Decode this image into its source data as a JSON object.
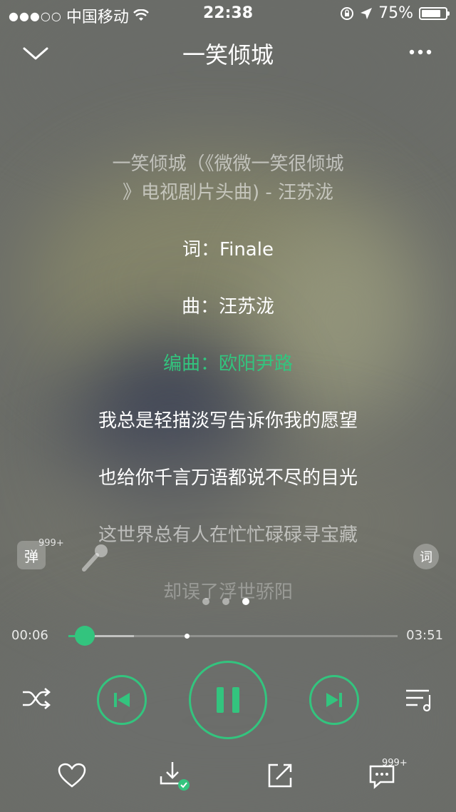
{
  "status": {
    "carrier": "中国移动",
    "time": "22:38",
    "battery": "75%"
  },
  "header": {
    "title": "一笑倾城",
    "back_icon": "chevron-down-icon",
    "more_icon": "more-icon"
  },
  "lyrics": {
    "heading_line1": "一笑倾城（《微微一笑很倾城",
    "heading_line2": "》电视剧片头曲) - 汪苏泷",
    "lines": [
      "词：Finale",
      "曲：汪苏泷",
      "编曲：欧阳尹路",
      "我总是轻描淡写告诉你我的愿望",
      "也给你千言万语都说不尽的目光",
      "这世界总有人在忙忙碌碌寻宝藏",
      "却误了浮世骄阳"
    ],
    "active_index": 2
  },
  "side": {
    "danmu_label": "弹",
    "danmu_count": "999+",
    "lyric_label": "词"
  },
  "pager": {
    "count": 3,
    "active": 2
  },
  "progress": {
    "elapsed": "00:06",
    "duration": "03:51",
    "played_fraction": 0.05,
    "buffered_fraction": 0.2
  },
  "bottom": {
    "comment_count": "999+"
  },
  "colors": {
    "accent": "#33c47e"
  }
}
